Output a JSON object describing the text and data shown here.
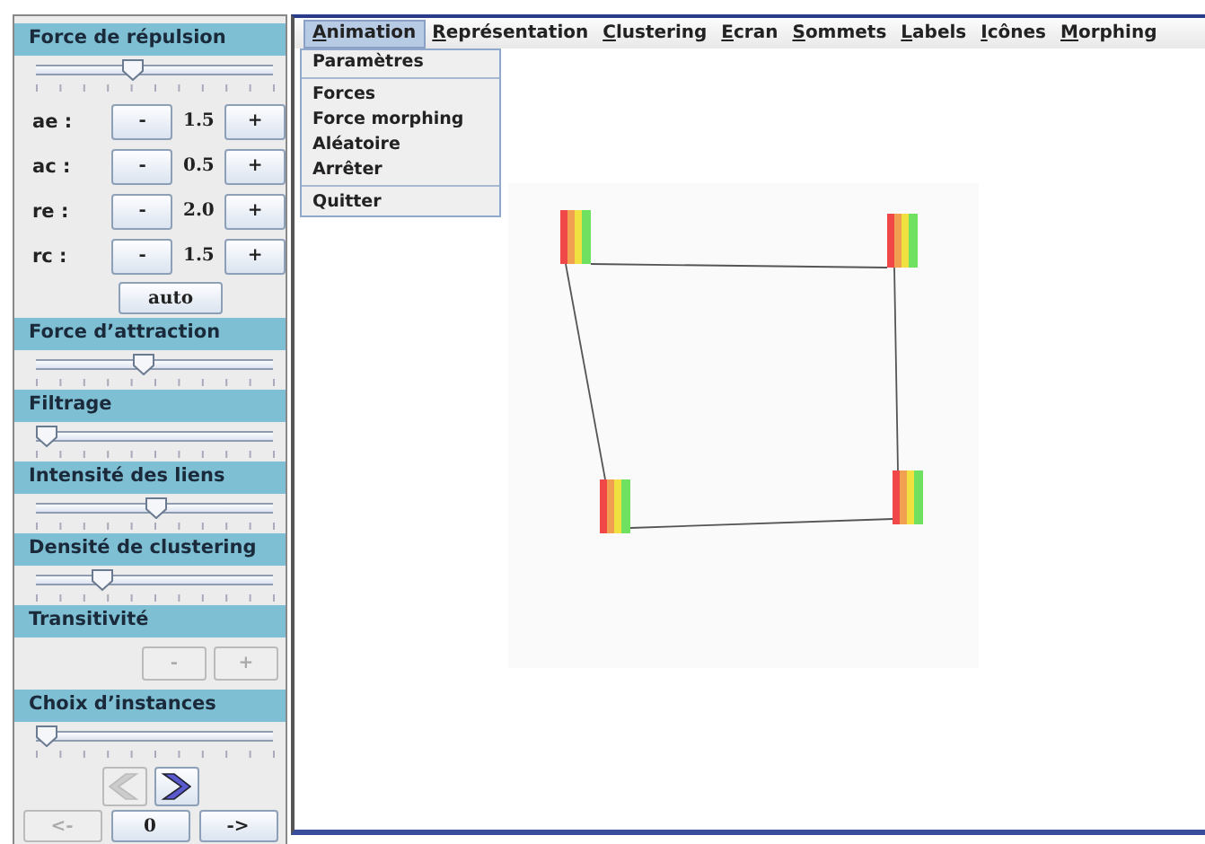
{
  "panel": {
    "sections": [
      {
        "title": "Force de répulsion",
        "slider": {
          "level": 0.4
        },
        "params": [
          {
            "label": "ae :",
            "minus": "-",
            "value": "1.5",
            "plus": "+"
          },
          {
            "label": "ac :",
            "minus": "-",
            "value": "0.5",
            "plus": "+"
          },
          {
            "label": "re :",
            "minus": "-",
            "value": "2.0",
            "plus": "+"
          },
          {
            "label": "rc :",
            "minus": "-",
            "value": "1.5",
            "plus": "+"
          }
        ],
        "auto": "auto"
      },
      {
        "title": "Force d’attraction",
        "slider": {
          "level": 0.45
        }
      },
      {
        "title": "Filtrage",
        "slider": {
          "level": 0
        }
      },
      {
        "title": "Intensité des liens",
        "slider": {
          "level": 0.51
        }
      },
      {
        "title": "Densité de clustering",
        "slider": {
          "level": 0.26
        }
      },
      {
        "title": "Transitivité",
        "buttons": [
          {
            "label": "-",
            "disabled": true
          },
          {
            "label": "+",
            "disabled": true
          }
        ]
      },
      {
        "title": "Choix d’instances",
        "slider": {
          "level": 0
        },
        "arrows": {
          "prev_disabled": true,
          "next_disabled": false
        },
        "nav": [
          {
            "label": "<-",
            "disabled": true
          },
          {
            "label": "0",
            "disabled": false
          },
          {
            "label": "->",
            "disabled": false
          }
        ]
      }
    ]
  },
  "menu": {
    "items": [
      {
        "label": "Animation",
        "selected": true
      },
      {
        "label": "Représentation",
        "selected": false
      },
      {
        "label": "Clustering",
        "selected": false
      },
      {
        "label": "Ecran",
        "selected": false
      },
      {
        "label": "Sommets",
        "selected": false
      },
      {
        "label": "Labels",
        "selected": false
      },
      {
        "label": "Icônes",
        "selected": false
      },
      {
        "label": "Morphing",
        "selected": false
      }
    ],
    "dropdown": [
      [
        "Paramètres"
      ],
      [
        "Forces",
        "Force morphing",
        "Aléatoire",
        "Arrêter"
      ],
      [
        "Quitter"
      ]
    ]
  }
}
